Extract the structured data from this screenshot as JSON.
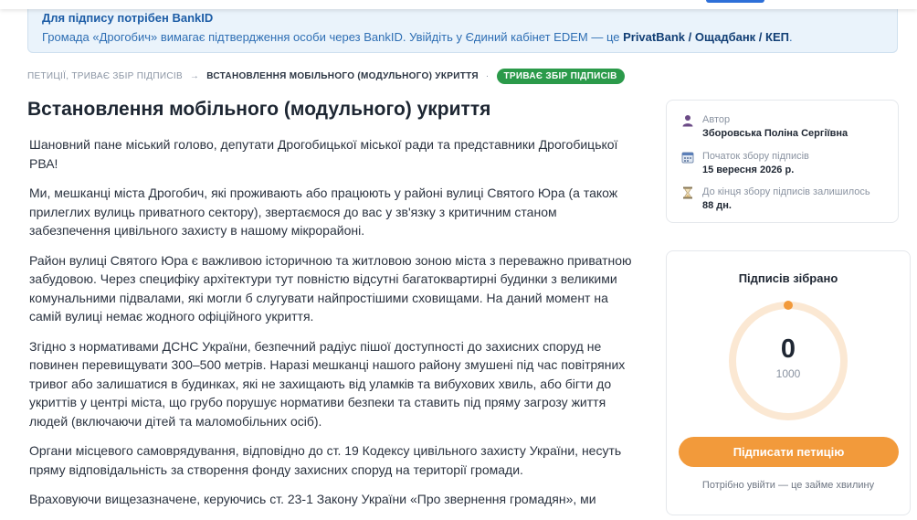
{
  "notice": {
    "title": "Для підпису потрібен BankID",
    "text_before": "Громада «Дрогобич» вимагає підтвердження особи через BankID. Увійдіть у Єдиний кабінет EDEM — це ",
    "text_bold": "PrivatBank / Ощадбанк / КЕП",
    "text_after": "."
  },
  "breadcrumb": {
    "parent": "ПЕТИЦІЇ, ТРИВАЄ ЗБІР ПІДПИСІВ",
    "arrow": "→",
    "current": "ВСТАНОВЛЕННЯ МОБІЛЬНОГО (МОДУЛЬНОГО) УКРИТТЯ",
    "dot": "·",
    "status": "ТРИВАЄ ЗБІР ПІДПИСІВ"
  },
  "petition": {
    "title": "Встановлення мобільного (модульного) укриття",
    "paragraphs": [
      "Шановний пане міський голово, депутати Дрогобицької міської ради та представники Дрогобицької РВА!",
      "Ми, мешканці міста Дрогобич, які проживають або працюють у районі вулиці Святого Юра (а також прилеглих вулиць приватного сектору), звертаємося до вас у зв'язку з критичним станом забезпечення цивільного захисту в нашому мікрорайоні.",
      "Район вулиці Святого Юра є важливою історичною та житловою зоною міста з переважно приватною забудовою. Через специфіку архітектури тут повністю відсутні багатоквартирні будинки з великими комунальними підвалами, які могли б слугувати найпростішими сховищами. На даний момент на самій вулиці немає жодного офіційного укриття.",
      "Згідно з нормативами ДСНС України, безпечний радіус пішої доступності до захисних споруд не повинен перевищувати 300–500 метрів. Наразі мешканці нашого району змушені під час повітряних тривог або залишатися в будинках, які не захищають від уламків та вибухових хвиль, або бігти до укриттів у центрі міста, що грубо порушує нормативи безпеки та ставить під пряму загрозу життя людей (включаючи дітей та маломобільних осіб).",
      "Органи місцевого самоврядування, відповідно до ст. 19 Кодексу цивільного захисту України, несуть пряму відповідальність за створення фонду захисних споруд на території громади.",
      "Враховуючи вищезазначене, керуючись ст. 23-1 Закону України «Про звернення громадян», ми"
    ]
  },
  "info": {
    "author_label": "Автор",
    "author_value": "Зборовська Поліна Сергіївна",
    "start_label": "Початок збору підписів",
    "start_value": "15 вересня 2026 р.",
    "remaining_label": "До кінця збору підписів залишилось",
    "remaining_value": "88 дн."
  },
  "signatures": {
    "title": "Підписів зібрано",
    "count": "0",
    "goal": "1000",
    "progress_fraction": 0,
    "button_label": "Підписати петицію",
    "hint": "Потрібно увійти — це займе хвилину"
  },
  "colors": {
    "accent_orange": "#f29a3b",
    "ring_track": "#fbe8d3",
    "status_green": "#2b9a4a",
    "notice_bg": "#eaf3fb"
  },
  "icons": [
    "user-icon",
    "calendar-icon",
    "hourglass-icon"
  ]
}
